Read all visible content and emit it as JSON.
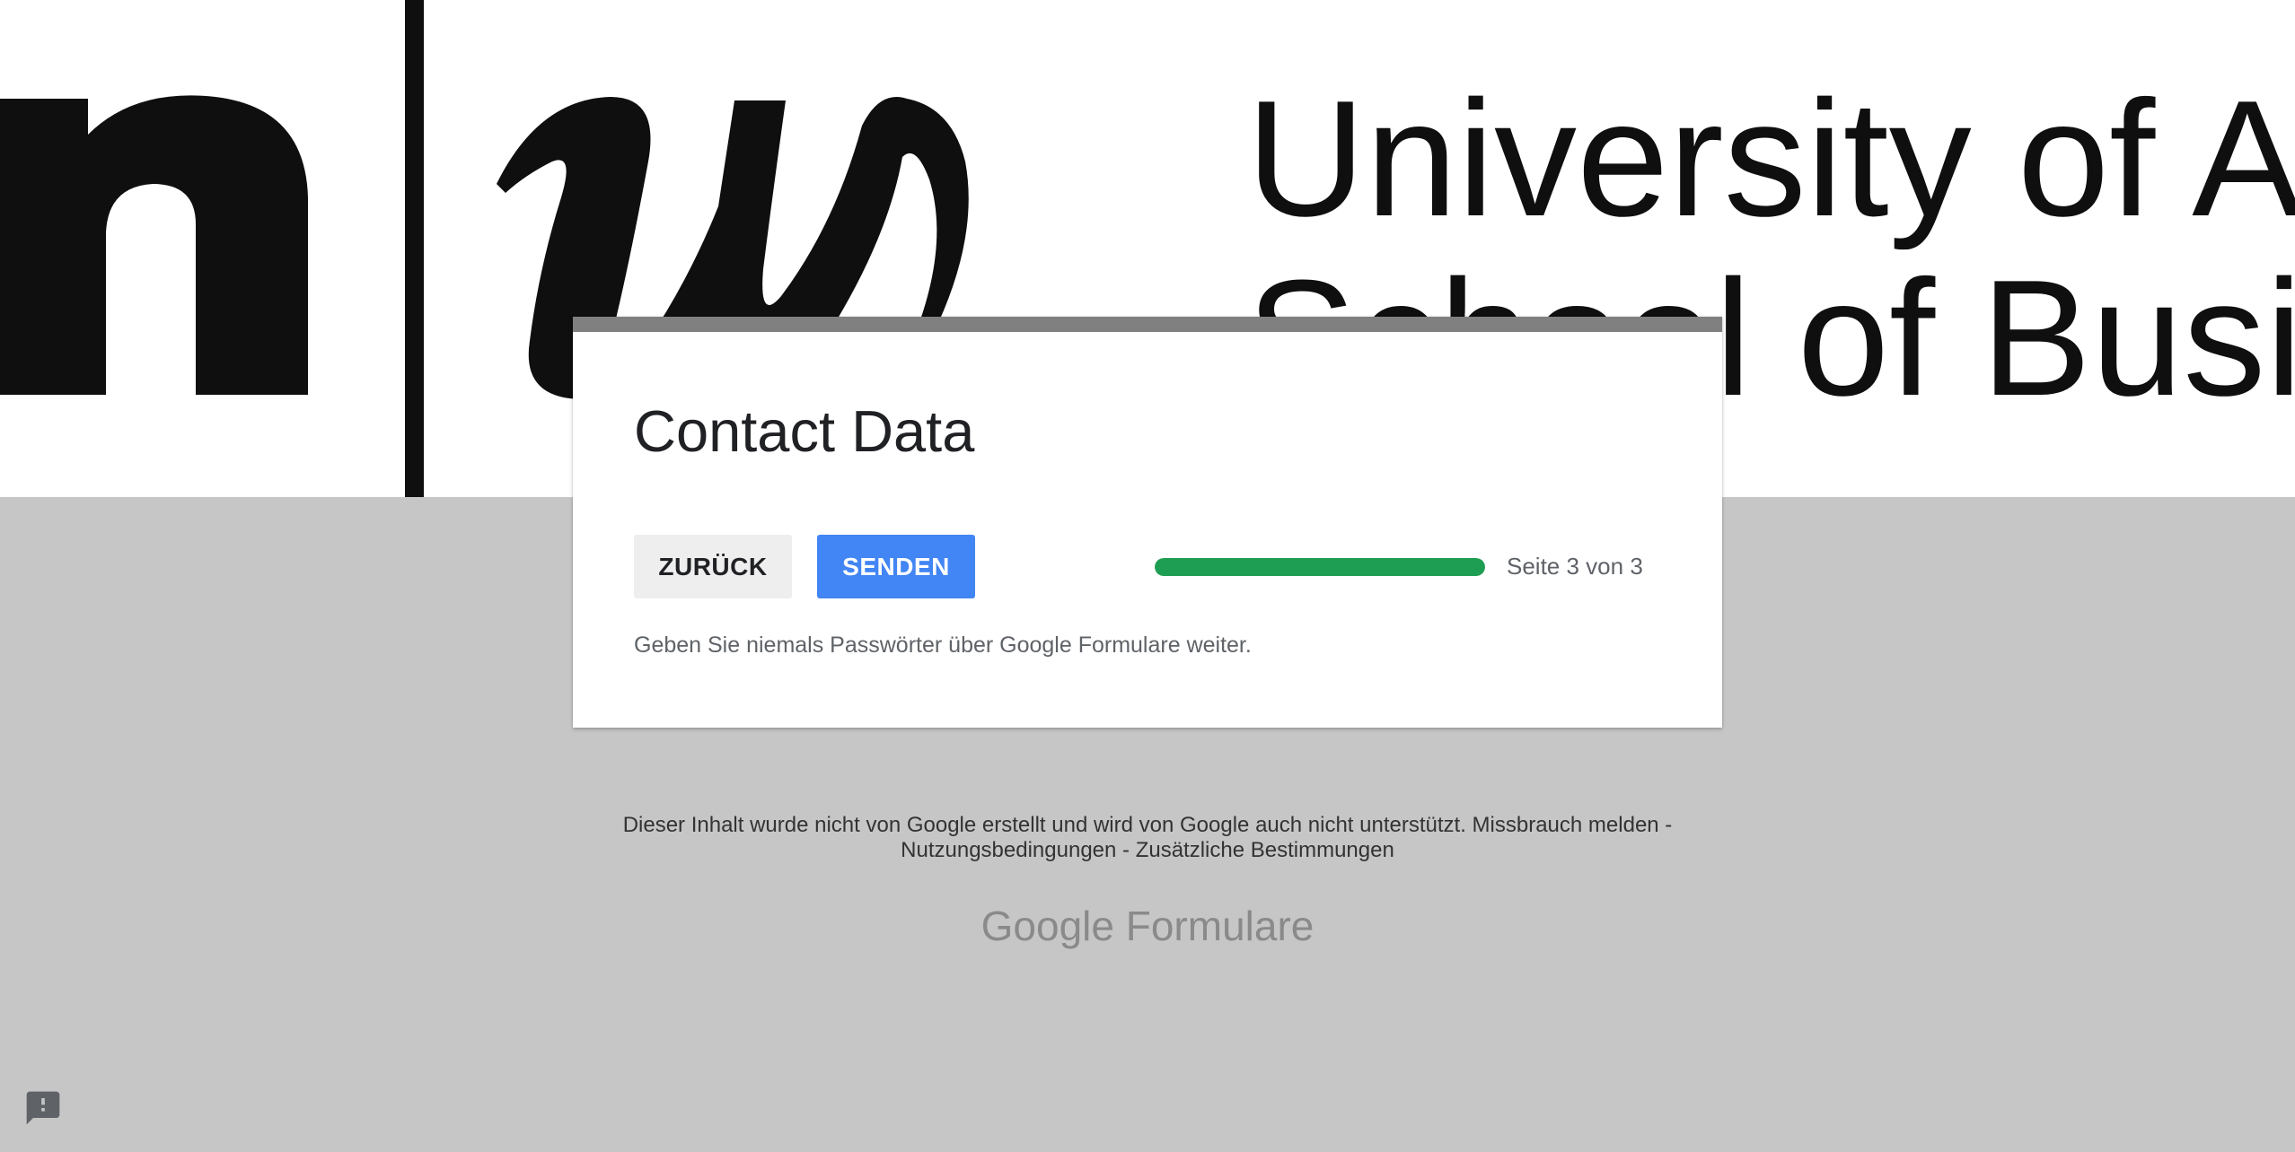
{
  "banner": {
    "logo_line1": "University of A",
    "logo_line2": "School of Busi"
  },
  "form": {
    "title": "Contact Data",
    "back_label": "ZURÜCK",
    "send_label": "SENDEN",
    "progress_fraction": 1.0,
    "progress_text": "Seite 3 von 3",
    "password_warning": "Geben Sie niemals Passwörter über Google Formulare weiter."
  },
  "footer": {
    "disclaimer": "Dieser Inhalt wurde nicht von Google erstellt und wird von Google auch nicht unterstützt.",
    "report_abuse": "Missbrauch melden",
    "separator": " - ",
    "terms": "Nutzungsbedingungen",
    "additional_terms": "Zusätzliche Bestimmungen",
    "brand_google": "Google",
    "brand_forms": "Formulare"
  },
  "icons": {
    "feedback": "feedback-icon"
  },
  "colors": {
    "background": "#c6c6c6",
    "card_topbar": "#808080",
    "send_button": "#4285f4",
    "progress": "#1e9e52"
  }
}
